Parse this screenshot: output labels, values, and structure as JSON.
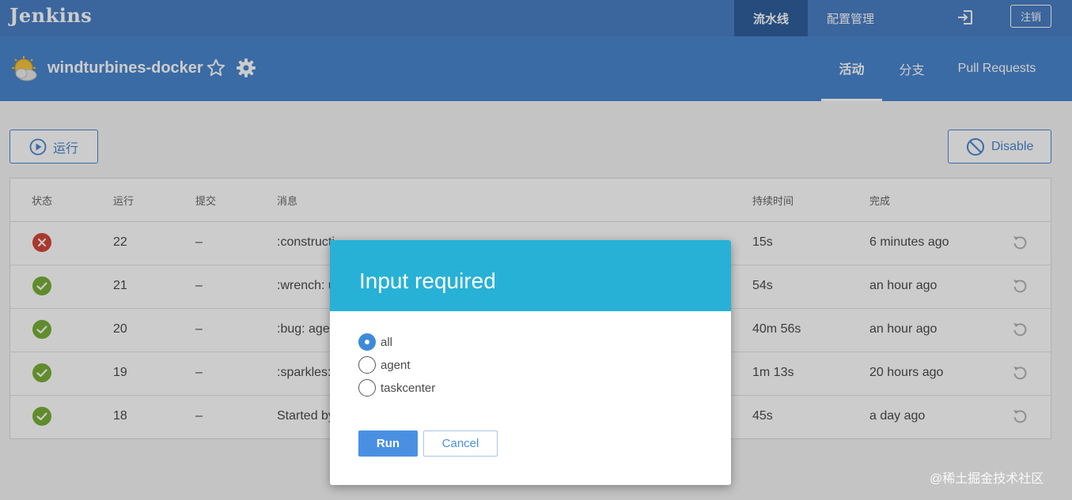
{
  "topbar": {
    "logo": "Jenkins",
    "nav_active": "流水线",
    "nav_item": "配置管理",
    "logout_label": "注销",
    "signin_icon": "sign-in-icon"
  },
  "pipeline": {
    "title": "windturbines-docker",
    "weather_icon": "weather-sun-cloud-icon",
    "tabs": [
      "活动",
      "分支",
      "Pull Requests"
    ]
  },
  "actions": {
    "run_label": "运行",
    "disable_label": "Disable"
  },
  "table": {
    "headers": [
      "状态",
      "运行",
      "提交",
      "消息",
      "持续时间",
      "完成"
    ],
    "rows": [
      {
        "status": "failed",
        "run": "22",
        "commit": "–",
        "message": ":constructi",
        "duration": "15s",
        "completed": "6 minutes ago"
      },
      {
        "status": "success",
        "run": "21",
        "commit": "–",
        "message": ":wrench: u",
        "duration": "54s",
        "completed": "an hour ago"
      },
      {
        "status": "success",
        "run": "20",
        "commit": "–",
        "message": ":bug: agen",
        "duration": "40m 56s",
        "completed": "an hour ago"
      },
      {
        "status": "success",
        "run": "19",
        "commit": "–",
        "message": ":sparkles: ",
        "duration": "1m 13s",
        "completed": "20 hours ago"
      },
      {
        "status": "success",
        "run": "18",
        "commit": "–",
        "message": "Started by",
        "duration": "45s",
        "completed": "a day ago"
      }
    ]
  },
  "modal": {
    "title": "Input required",
    "options": [
      {
        "label": "all",
        "checked": true
      },
      {
        "label": "agent",
        "checked": false
      },
      {
        "label": "taskcenter",
        "checked": false
      }
    ],
    "run_label": "Run",
    "cancel_label": "Cancel"
  },
  "watermark": "@稀土掘金技术社区",
  "colors": {
    "topbar": "#4a7fc5",
    "subheader": "#4a86cf",
    "modal_header": "#27b1d7",
    "success": "#78b037",
    "failure": "#d24939",
    "primary": "#4a90e2"
  }
}
